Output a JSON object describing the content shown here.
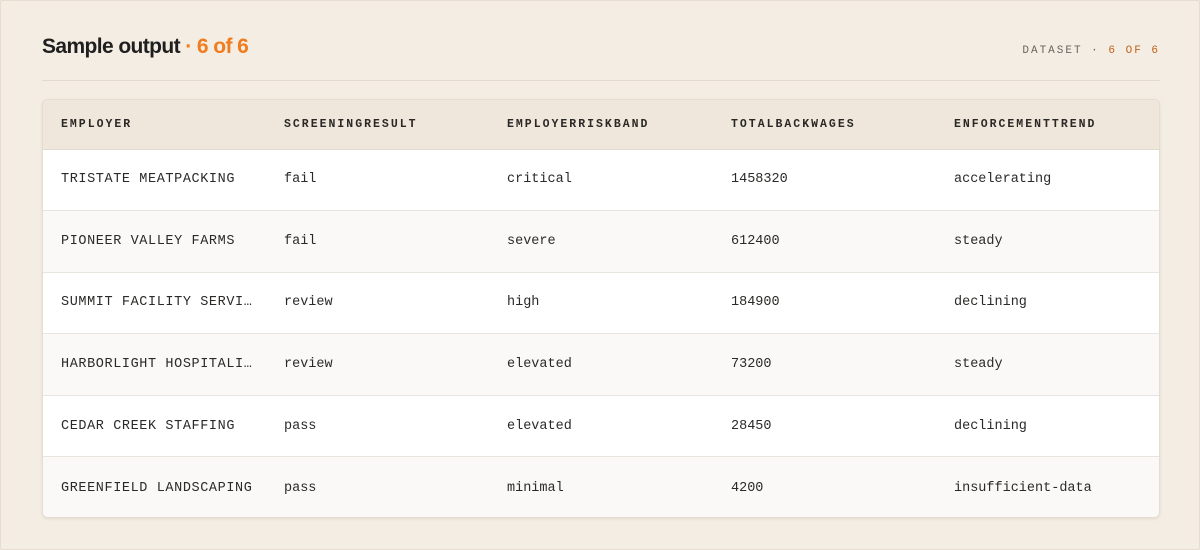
{
  "header": {
    "title": "Sample output",
    "separator": " · ",
    "count": "6 of 6",
    "dataset_prefix": "DATASET · ",
    "dataset_count": "6 OF 6"
  },
  "table": {
    "columns": [
      "EMPLOYER",
      "SCREENINGRESULT",
      "EMPLOYERRISKBAND",
      "TOTALBACKWAGES",
      "ENFORCEMENTTREND"
    ],
    "rows": [
      [
        "TRISTATE MEATPACKING",
        "fail",
        "critical",
        "1458320",
        "accelerating"
      ],
      [
        "PIONEER VALLEY FARMS",
        "fail",
        "severe",
        "612400",
        "steady"
      ],
      [
        "SUMMIT FACILITY SERVIC…",
        "review",
        "high",
        "184900",
        "declining"
      ],
      [
        "HARBORLIGHT HOSPITALITY",
        "review",
        "elevated",
        "73200",
        "steady"
      ],
      [
        "CEDAR CREEK STAFFING",
        "pass",
        "elevated",
        "28450",
        "declining"
      ],
      [
        "GREENFIELD LANDSCAPING",
        "pass",
        "minimal",
        "4200",
        "insufficient-data"
      ]
    ]
  }
}
